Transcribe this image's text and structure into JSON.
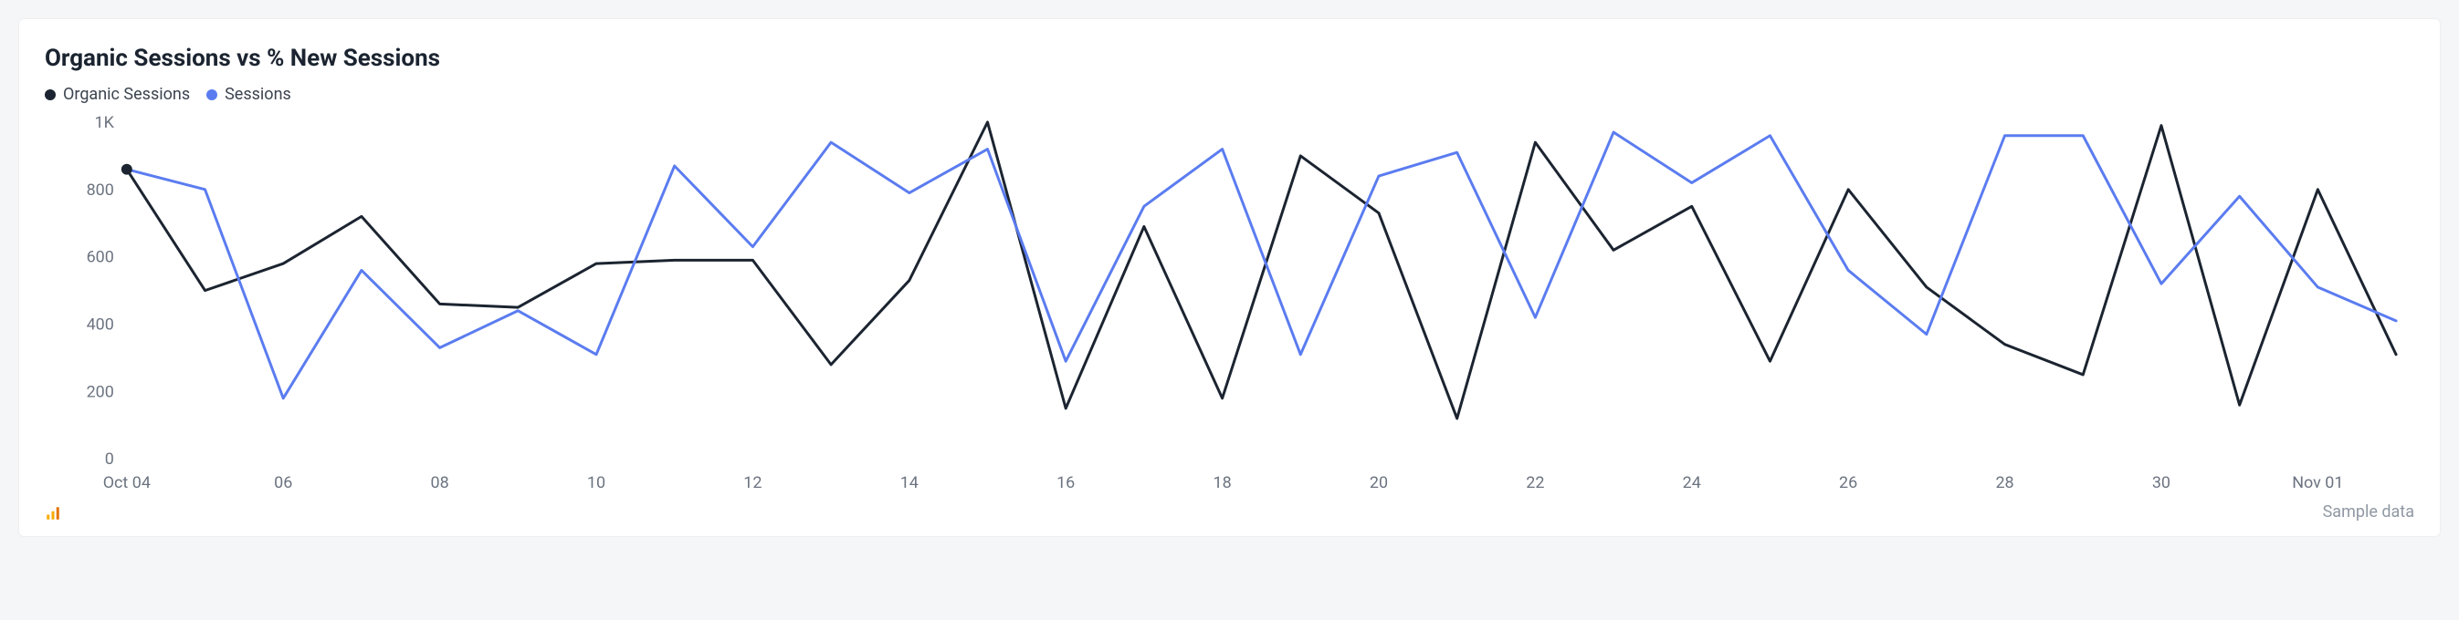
{
  "title": "Organic Sessions vs % New Sessions",
  "legend": [
    {
      "name": "Organic Sessions",
      "color": "#1b2430"
    },
    {
      "name": "Sessions",
      "color": "#5b7cf0"
    }
  ],
  "footer_label": "Sample data",
  "chart_data": {
    "type": "line",
    "xlabel": "",
    "ylabel": "",
    "ylim": [
      0,
      1000
    ],
    "y_ticks": [
      0,
      200,
      400,
      600,
      800,
      1000
    ],
    "y_tick_labels": [
      "0",
      "200",
      "400",
      "600",
      "800",
      "1K"
    ],
    "x_tick_every": 2,
    "categories": [
      "Oct 04",
      "05",
      "06",
      "07",
      "08",
      "09",
      "10",
      "11",
      "12",
      "13",
      "14",
      "15",
      "16",
      "17",
      "18",
      "19",
      "20",
      "21",
      "22",
      "23",
      "24",
      "25",
      "26",
      "27",
      "28",
      "29",
      "30",
      "31",
      "Nov 01",
      "02"
    ],
    "series": [
      {
        "name": "Organic Sessions",
        "color": "#1b2430",
        "values": [
          860,
          500,
          580,
          720,
          460,
          450,
          580,
          590,
          590,
          280,
          530,
          1000,
          150,
          690,
          180,
          900,
          730,
          120,
          940,
          620,
          750,
          290,
          800,
          510,
          340,
          250,
          990,
          160,
          800,
          310
        ]
      },
      {
        "name": "Sessions",
        "color": "#5b7cf0",
        "values": [
          860,
          800,
          180,
          560,
          330,
          440,
          310,
          870,
          630,
          940,
          790,
          920,
          290,
          750,
          920,
          310,
          840,
          910,
          420,
          970,
          820,
          960,
          560,
          370,
          960,
          960,
          520,
          780,
          510,
          410
        ]
      }
    ]
  }
}
